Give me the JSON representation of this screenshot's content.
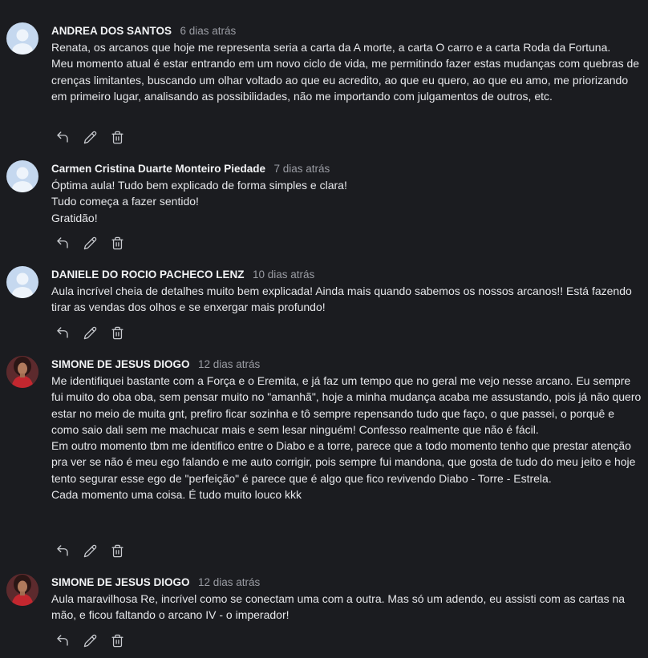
{
  "comments": [
    {
      "author": "ANDREA DOS SANTOS",
      "time": "6 dias atrás",
      "avatar": "default-avatar",
      "lines": [
        "Renata, os arcanos que hoje me representa seria a carta da A morte, a carta O carro e a carta Roda da Fortuna.",
        "Meu momento atual é estar entrando em um novo ciclo de vida, me permitindo fazer estas mudanças com quebras de crenças limitantes, buscando um olhar voltado ao que eu acredito, ao que eu quero, ao que eu amo, me priorizando em primeiro lugar, analisando as possibilidades, não me importando com julgamentos de outros, etc."
      ]
    },
    {
      "author": "Carmen Cristina Duarte Monteiro Piedade",
      "time": "7 dias atrás",
      "avatar": "default-avatar",
      "lines": [
        "Óptima aula! Tudo bem explicado de forma simples e clara!",
        "Tudo começa a fazer sentido!",
        "Gratidão!"
      ]
    },
    {
      "author": "DANIELE DO ROCIO PACHECO LENZ",
      "time": "10 dias atrás",
      "avatar": "default-avatar",
      "lines": [
        "Aula incrível cheia de detalhes muito bem explicada! Ainda mais quando sabemos os nossos arcanos!! Está fazendo tirar as vendas dos olhos e se enxergar mais profundo!"
      ]
    },
    {
      "author": "SIMONE DE JESUS DIOGO",
      "time": "12 dias atrás",
      "avatar": "photo-avatar",
      "lines": [
        "Me identifiquei bastante com a Força e o Eremita, e já faz um tempo que no geral me vejo nesse arcano. Eu sempre fui muito do oba oba, sem pensar muito no \"amanhã\", hoje a minha mudança acaba me assustando, pois já não quero estar no meio de muita gnt, prefiro ficar sozinha e tô sempre repensando tudo que faço, o que passei, o porquê e como saio dali sem me machucar mais e sem lesar ninguém! Confesso realmente que não é fácil.",
        "Em outro momento tbm me identifico entre o Diabo e a torre, parece que a todo momento tenho que prestar atenção pra ver se não é meu ego falando e me auto corrigir, pois sempre fui mandona, que gosta de tudo do meu jeito e hoje tento segurar esse ego de \"perfeição\" é parece que é algo que fico revivendo Diabo - Torre - Estrela.",
        "Cada momento uma coisa. É tudo muito louco kkk"
      ]
    },
    {
      "author": "SIMONE DE JESUS DIOGO",
      "time": "12 dias atrás",
      "avatar": "photo-avatar",
      "lines": [
        "Aula maravilhosa Re, incrível como se conectam uma com a outra. Mas só um adendo, eu assisti com as cartas na mão, e ficou faltando o arcano IV - o imperador!"
      ]
    }
  ],
  "icons": {
    "reply": "reply-icon",
    "edit": "pencil-icon",
    "delete": "trash-icon"
  },
  "colors": {
    "background": "#1b1c20",
    "text": "#e6e7ea",
    "muted": "#9a9ca3",
    "default_avatar": "#c5d8ef"
  }
}
